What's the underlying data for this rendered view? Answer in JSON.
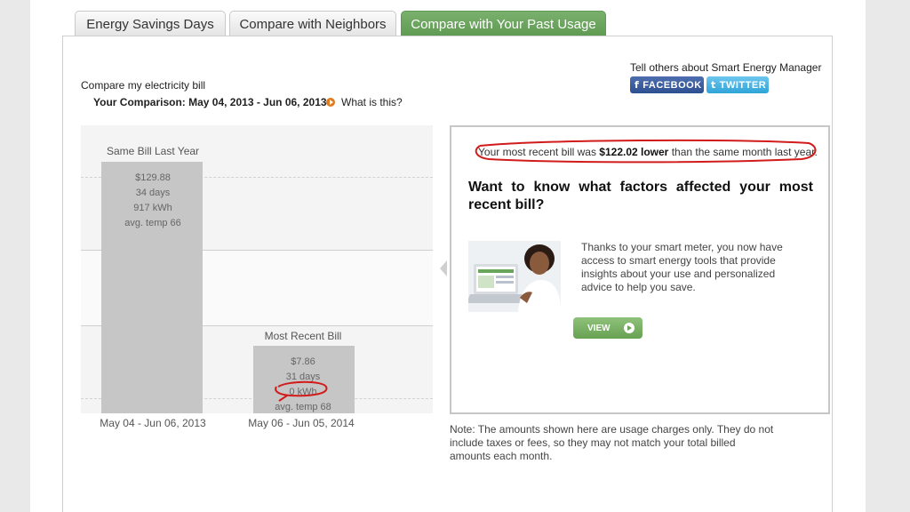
{
  "tabs": [
    {
      "label": "Energy Savings Days"
    },
    {
      "label": "Compare with Neighbors"
    },
    {
      "label": "Compare with Your Past Usage"
    }
  ],
  "header": {
    "compare_title": "Compare my electricity bill",
    "comparison": "Your Comparison: May 04, 2013 - Jun 06, 2013",
    "what_is_this": "What is this?",
    "tell_others": "Tell others about Smart Energy Manager",
    "facebook_label": "FACEBOOK",
    "twitter_label": "TWITTER"
  },
  "chart_data": {
    "type": "bar",
    "categories": [
      "May 04 - Jun 06, 2013",
      "May 06 - Jun 05, 2014"
    ],
    "series_labels": [
      "Same Bill Last Year",
      "Most Recent Bill"
    ],
    "values": [
      129.88,
      7.86
    ],
    "details": [
      [
        "$129.88",
        "34 days",
        "917 kWh",
        "avg. temp 66"
      ],
      [
        "$7.86",
        "31 days",
        "0 kWh",
        "avg. temp 68"
      ]
    ]
  },
  "callout": {
    "recent_prefix": "Your most recent bill was ",
    "recent_amount": "$122.02 lower",
    "recent_suffix": " than the same month last year.",
    "question": "Want to know what factors affected your most recent bill?",
    "blurb": "Thanks to your smart meter, you now have access to smart energy tools that provide insights about your use and personalized advice to help you save.",
    "view_label": "VIEW"
  },
  "note": "Note: The amounts shown here are usage charges only. They do not include taxes or fees, so they may not match your total billed amounts each month.",
  "colors": {
    "active_tab": "#6aa55c",
    "facebook": "#3b5998",
    "twitter": "#3ab0e2",
    "annotation": "#d21b1b",
    "bar": "#c6c6c6"
  }
}
